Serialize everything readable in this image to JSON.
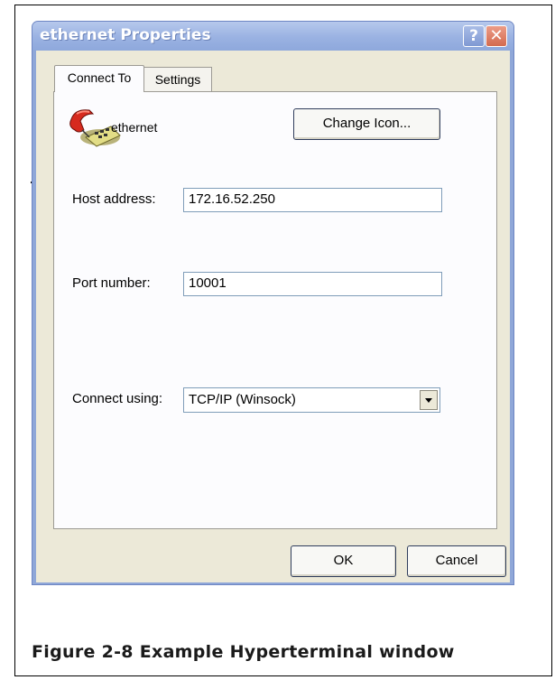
{
  "window": {
    "title": "ethernet Properties",
    "help_label": "?",
    "close_label": "✕"
  },
  "tabs": [
    {
      "label": "Connect To",
      "active": true
    },
    {
      "label": "Settings",
      "active": false
    }
  ],
  "connection": {
    "icon": "telephone-icon",
    "name": "ethernet",
    "change_icon_label": "Change Icon..."
  },
  "fields": {
    "host_label": "Host address:",
    "host_value": "172.16.52.250",
    "port_label": "Port number:",
    "port_value": "10001",
    "connect_label": "Connect using:",
    "connect_value": "TCP/IP (Winsock)"
  },
  "buttons": {
    "ok": "OK",
    "cancel": "Cancel"
  },
  "caption": "Figure 2-8 Example Hyperterminal window",
  "colors": {
    "titlebar": "#9ab2e2",
    "client": "#ece9d8",
    "close": "#d36a4f"
  }
}
